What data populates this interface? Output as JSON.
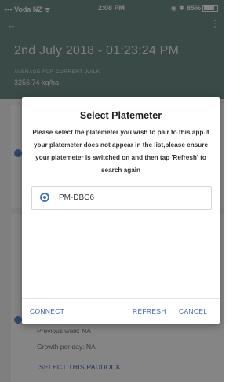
{
  "status_bar": {
    "carrier": "Voda NZ",
    "time": "2:08 PM",
    "battery": "85%"
  },
  "header": {
    "title": "2nd July  2018 - 01:23:24 PM",
    "subtitle": "AVERAGE FOR CURRENT WALK",
    "value": "3256.74 kg/ha"
  },
  "background": {
    "previous_walk": "Previous walk: NA",
    "growth": "Growth per day: NA",
    "select_paddock": "SELECT THIS PADDOCK"
  },
  "dialog": {
    "title": "Select Platemeter",
    "message": "Please select the platemeter you wish to pair to this app.If your platemeter does not appear in the list,please ensure your platemeter is switched on and then tap 'Refresh' to search again",
    "options": [
      {
        "label": "PM-DBC6",
        "selected": true
      }
    ],
    "buttons": {
      "connect": "CONNECT",
      "refresh": "REFRESH",
      "cancel": "CANCEL"
    }
  },
  "colors": {
    "header": "#6f8f86",
    "accent": "#3d73d7",
    "link": "#3f64b5"
  }
}
